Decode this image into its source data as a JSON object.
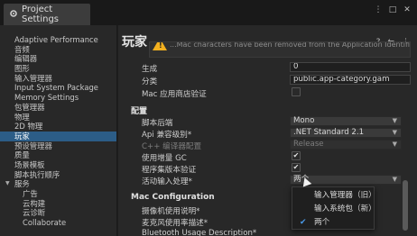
{
  "window": {
    "title": "Project Settings",
    "menu_icon": "kebab-icon",
    "controls": [
      "⋮",
      "□",
      "✕"
    ]
  },
  "sidebar": {
    "items": [
      {
        "label": "Adaptive Performance",
        "child": false
      },
      {
        "label": "音频",
        "child": false
      },
      {
        "label": "编辑器",
        "child": false
      },
      {
        "label": "图形",
        "child": false
      },
      {
        "label": "输入管理器",
        "child": false
      },
      {
        "label": "Input System Package",
        "child": false
      },
      {
        "label": "Memory Settings",
        "child": false
      },
      {
        "label": "包管理器",
        "child": false
      },
      {
        "label": "物理",
        "child": false
      },
      {
        "label": "2D 物理",
        "child": false
      },
      {
        "label": "玩家",
        "child": false,
        "selected": true
      },
      {
        "label": "预设管理器",
        "child": false
      },
      {
        "label": "质量",
        "child": false
      },
      {
        "label": "场景模板",
        "child": false
      },
      {
        "label": "脚本执行顺序",
        "child": false
      },
      {
        "label": "服务",
        "child": false,
        "expanded": true
      },
      {
        "label": "广告",
        "child": true
      },
      {
        "label": "云构建",
        "child": true
      },
      {
        "label": "云诊断",
        "child": true
      },
      {
        "label": "Collaborate",
        "child": true
      }
    ]
  },
  "main": {
    "title": "玩家",
    "warning_text": "...Mac characters have been removed from the Application Identifier",
    "fields": {
      "build_label": "生成",
      "build_value": "0",
      "category_label": "分类",
      "category_value": "public.app-category.gam",
      "mac_store_label": "Mac 应用商店验证"
    },
    "config_section": "配置",
    "config": {
      "scripting_backend_label": "脚本后端",
      "scripting_backend_value": "Mono",
      "api_level_label": "Api 兼容级别*",
      "api_level_value": ".NET Standard 2.1",
      "cpp_config_label": "C++ 编译器配置",
      "cpp_config_value": "Release",
      "incremental_gc_label": "使用增量 GC",
      "assembly_validation_label": "程序集版本验证",
      "active_input_label": "活动输入处理*",
      "active_input_value": "两个"
    },
    "mac_section": "Mac Configuration",
    "mac": {
      "camera_label": "摄像机使用说明*",
      "mic_label": "麦克风使用率描述*",
      "bluetooth_label": "Bluetooth Usage Description*"
    }
  },
  "popup": {
    "options": [
      {
        "label": "输入管理器（旧）",
        "checked": false
      },
      {
        "label": "输入系统包（新）",
        "checked": false
      },
      {
        "label": "两个",
        "checked": true
      }
    ]
  },
  "colors": {
    "selection": "#2c5d87",
    "warning": "#f2b01f",
    "check_accent": "#4a9ae8"
  }
}
